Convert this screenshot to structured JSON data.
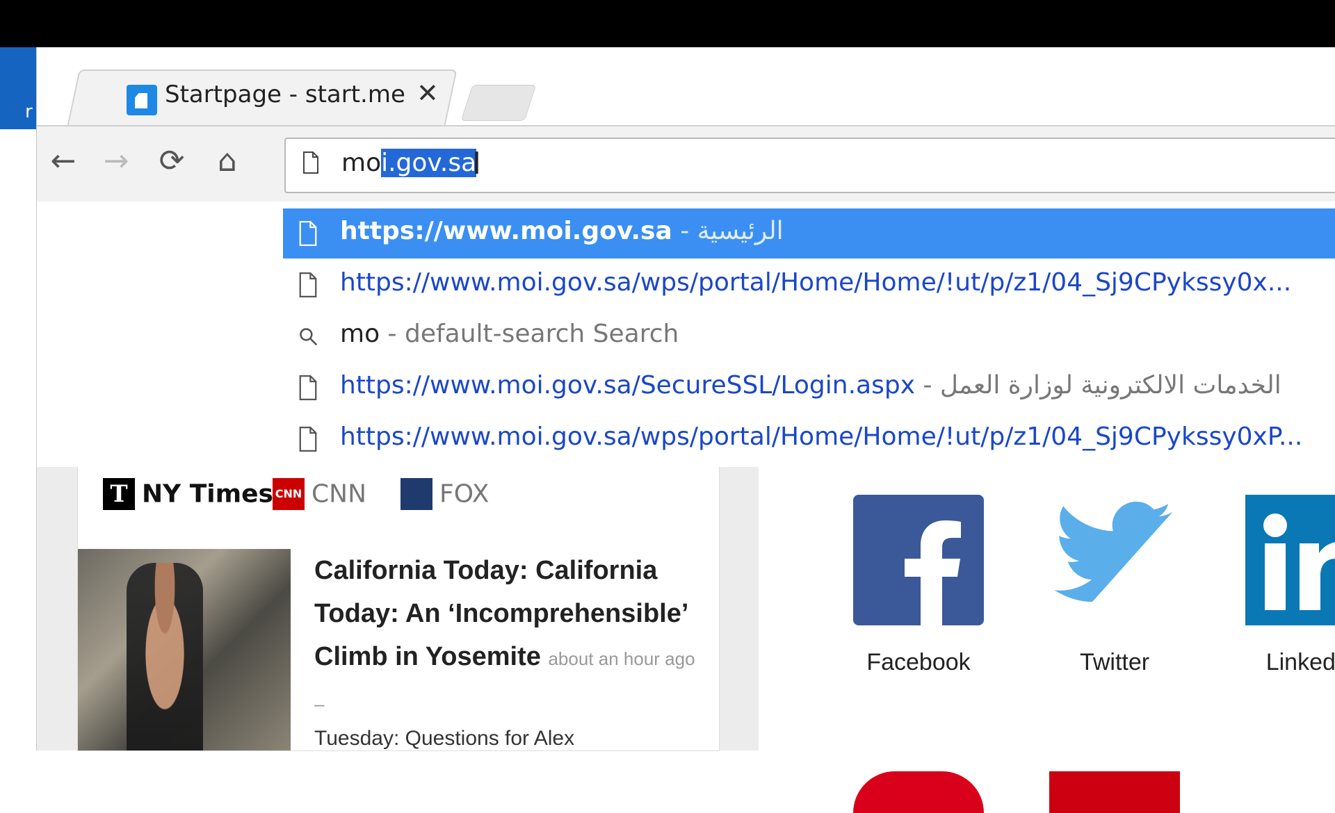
{
  "tab": {
    "title": "Startpage - start.me",
    "close_glyph": "✕"
  },
  "toolbar": {
    "back": "←",
    "forward": "→",
    "reload": "⟳",
    "home": "⌂"
  },
  "omnibox": {
    "typed": "mo",
    "autocomplete": "i.gov.sa"
  },
  "suggestions": [
    {
      "icon": "page-icon",
      "url": "https://www.moi.gov.sa",
      "desc": " - الرئيسية",
      "selected": true
    },
    {
      "icon": "page-icon",
      "url": "https://www.moi.gov.sa/wps/portal/Home/Home/!ut/p/z1/04_Sj9CPykssy0x...",
      "desc": ""
    },
    {
      "icon": "search-icon",
      "url": "mo",
      "desc": " - default-search Search"
    },
    {
      "icon": "page-icon",
      "url": "https://www.moi.gov.sa/SecureSSL/Login.aspx",
      "desc": " - الخدمات الالكترونية لوزارة العمل"
    },
    {
      "icon": "page-icon",
      "url": "https://www.moi.gov.sa/wps/portal/Home/Home/!ut/p/z1/04_Sj9CPykssy0xP...",
      "desc": ""
    }
  ],
  "news": {
    "sources": [
      {
        "label": "NY Times",
        "color": "#000000"
      },
      {
        "label": "CNN",
        "color": "#cc0000"
      },
      {
        "label": "FOX",
        "color": "#1f3b6e"
      }
    ],
    "headline": "California Today: California Today: An ‘Incomprehensible’ Climb in Yosemite",
    "time": "about an hour ago –",
    "snippet": "Tuesday: Questions for Alex"
  },
  "social": [
    {
      "label": "Facebook",
      "color": "#3b5998"
    },
    {
      "label": "Twitter",
      "color": "#55acee"
    },
    {
      "label": "LinkedIn",
      "color": "#0077b5"
    }
  ]
}
